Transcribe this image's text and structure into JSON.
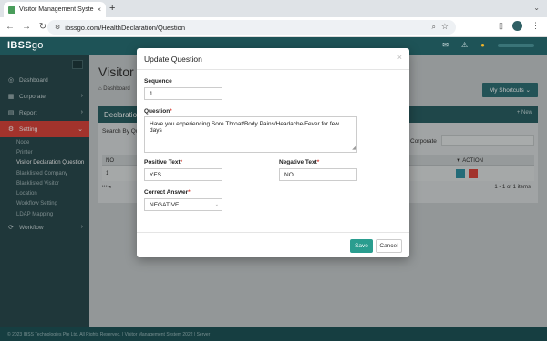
{
  "browser": {
    "tab_title": "Visitor Management System",
    "url": "ibssgo.com/HealthDeclaration/Question",
    "zoom_icon": "magnifier-icon",
    "bookmark_icon": "star-icon"
  },
  "app": {
    "logo_a": "IBSS",
    "logo_b": "go",
    "brand_color": "#1e5357"
  },
  "sidebar": {
    "items": [
      {
        "label": "Dashboard"
      },
      {
        "label": "Corporate"
      },
      {
        "label": "Report"
      },
      {
        "label": "Setting"
      },
      {
        "label": "Workflow"
      }
    ],
    "setting_sub": [
      "Node",
      "Printer",
      "Visitor Declaration Question",
      "Blacklisted Company",
      "Blacklisted Visitor",
      "Location",
      "Workflow Setting",
      "LDAP Mapping"
    ],
    "active_color": "#d9453b"
  },
  "main": {
    "title": "Visitor De",
    "breadcrumb": "Dashboard",
    "shortcuts": "My Shortcuts",
    "panel_title": "Declaration",
    "new_btn": "+ New",
    "search_label": "Search By Qu",
    "corporate_label": "Corporate",
    "col_no": "NO",
    "col_action": "ACTION",
    "row_no": "1",
    "pager_info": "1 - 1 of 1 items"
  },
  "footer": {
    "text": "© 2023 IBSS Technologies Pte Ltd. All Rights Reserved. | Visitor Management System 2022 | Server"
  },
  "modal": {
    "title": "Update Question",
    "close": "×",
    "sequence_label": "Sequence",
    "sequence_value": "1",
    "question_label": "Question",
    "question_value": "Have you experiencing Sore Throat/Body Pains/Headache/Fever for few days",
    "positive_label": "Positive Text",
    "positive_value": "YES",
    "negative_label": "Negative Text",
    "negative_value": "NO",
    "correct_label": "Correct Answer",
    "correct_value": "NEGATIVE",
    "required_mark": "*",
    "save": "Save",
    "cancel": "Cancel",
    "save_color": "#2a9d8f"
  }
}
